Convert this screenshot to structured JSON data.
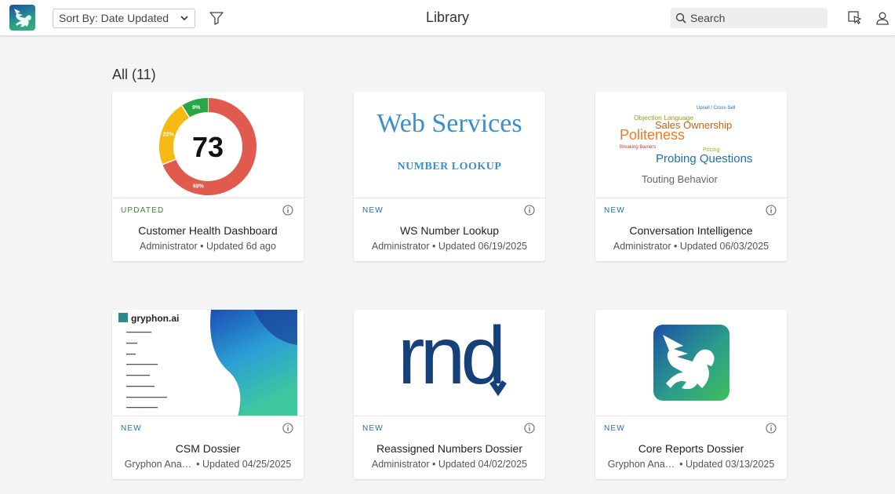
{
  "header": {
    "title": "Library",
    "sort_label": "Sort By: Date Updated",
    "search_placeholder": "Search"
  },
  "section": {
    "label": "All (11)"
  },
  "cards": [
    {
      "badge": "UPDATED",
      "name": "Customer Health Dashboard",
      "owner": "Administrator",
      "updated": "Updated 6d ago",
      "thumb": {
        "score": "73",
        "segments": [
          {
            "label": "69%",
            "value": 69,
            "color": "#e05a4e"
          },
          {
            "label": "22%",
            "value": 22,
            "color": "#f5b912"
          },
          {
            "label": "9%",
            "value": 9,
            "color": "#28a745"
          }
        ]
      }
    },
    {
      "badge": "NEW",
      "name": "WS Number Lookup",
      "owner": "Administrator",
      "updated": "Updated 06/19/2025",
      "thumb": {
        "headline": "Web Services",
        "subline": "NUMBER LOOKUP"
      }
    },
    {
      "badge": "NEW",
      "name": "Conversation Intelligence",
      "owner": "Administrator",
      "updated": "Updated 06/03/2025",
      "thumb": {
        "words": [
          "Upsell / Cross-Sell",
          "Objection Language",
          "Sales Ownership",
          "Politeness",
          "Breaking Barriers",
          "Pricing",
          "Probing Questions",
          "Touting Behavior"
        ]
      }
    },
    {
      "badge": "NEW",
      "name": "CSM Dossier",
      "owner": "Gryphon Anal…",
      "updated": "Updated 04/25/2025",
      "thumb": {
        "brand": "gryphon.ai"
      }
    },
    {
      "badge": "NEW",
      "name": "Reassigned Numbers Dossier",
      "owner": "Administrator",
      "updated": "Updated 04/02/2025",
      "thumb": {
        "logo_text": "rnd"
      }
    },
    {
      "badge": "NEW",
      "name": "Core Reports Dossier",
      "owner": "Gryphon Anal…",
      "updated": "Updated 03/13/2025",
      "thumb": {}
    }
  ],
  "colors": {
    "accent": "#1f6fb0",
    "updated_badge": "#3a8a2a",
    "dark_blue": "#15407a"
  }
}
